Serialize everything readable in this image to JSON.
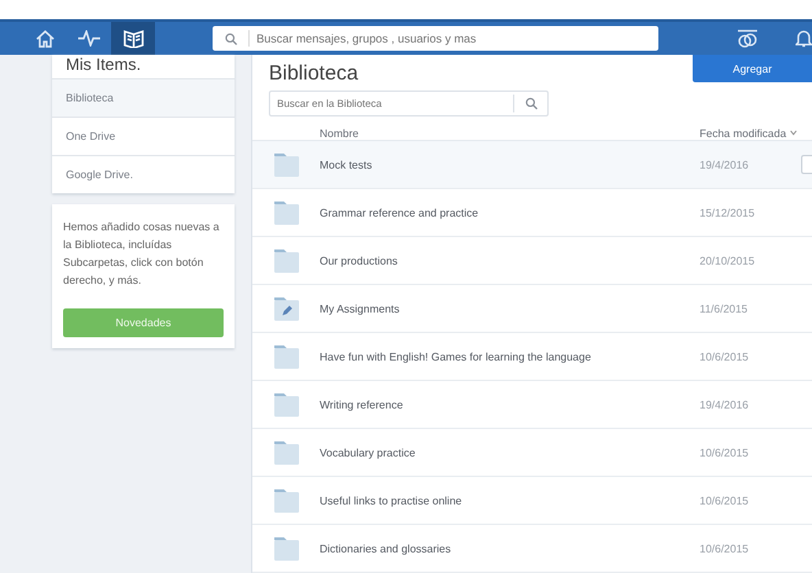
{
  "navbar": {
    "search": {
      "placeholder": "Buscar mensajes, grupos , usuarios y mas"
    },
    "nav_items": [
      {
        "kind": "home",
        "selected": false
      },
      {
        "kind": "activity",
        "selected": false
      },
      {
        "kind": "library",
        "selected": true
      }
    ]
  },
  "sidebar": {
    "title": "Mis Items.",
    "items": [
      {
        "label": "Biblioteca",
        "selected": true
      },
      {
        "label": "One Drive",
        "selected": false
      },
      {
        "label": "Google Drive.",
        "selected": false
      }
    ],
    "notice": {
      "text": "Hemos añadido cosas nuevas a la Biblioteca, incluídas Subcarpetas, click con botón derecho, y más.",
      "button": "Novedades"
    }
  },
  "main": {
    "title": "Biblioteca",
    "add_button": "Agregar",
    "search": {
      "placeholder": "Buscar en la Biblioteca"
    },
    "columns": [
      "Nombre",
      "Fecha modificada"
    ],
    "rows": [
      {
        "name": "Mock tests",
        "date": "19/4/2016",
        "kind": "folder",
        "selected": true
      },
      {
        "name": "Grammar reference and practice",
        "date": "15/12/2015",
        "kind": "folder",
        "selected": false
      },
      {
        "name": "Our productions",
        "date": "20/10/2015",
        "kind": "folder",
        "selected": false
      },
      {
        "name": "My Assignments",
        "date": "11/6/2015",
        "kind": "assignments",
        "selected": false
      },
      {
        "name": "Have fun with English! Games for learning the language",
        "date": "10/6/2015",
        "kind": "folder",
        "selected": false
      },
      {
        "name": "Writing reference",
        "date": "19/4/2016",
        "kind": "folder",
        "selected": false
      },
      {
        "name": "Vocabulary practice",
        "date": "10/6/2015",
        "kind": "folder",
        "selected": false
      },
      {
        "name": "Useful links to practise online",
        "date": "10/6/2015",
        "kind": "folder",
        "selected": false
      },
      {
        "name": "Dictionaries and glossaries",
        "date": "10/6/2015",
        "kind": "folder",
        "selected": false
      }
    ]
  }
}
